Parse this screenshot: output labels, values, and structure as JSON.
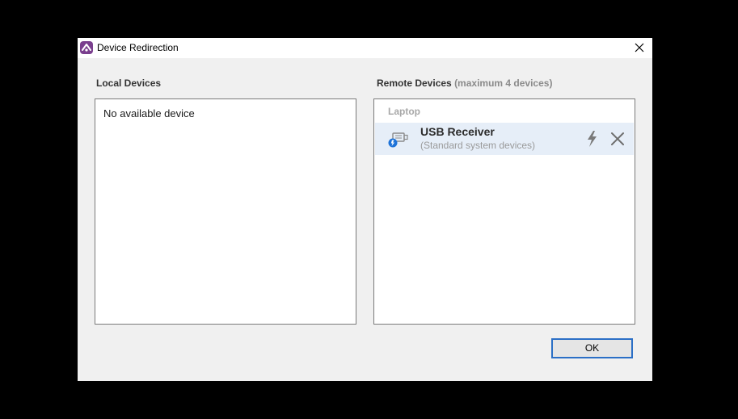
{
  "window": {
    "title": "Device Redirection",
    "app_icon": "anydesk-style-app-icon",
    "close_icon": "close-icon"
  },
  "local": {
    "label": "Local Devices",
    "empty_text": "No available device"
  },
  "remote": {
    "label": "Remote Devices",
    "label_sub": "(maximum 4 devices)",
    "group": "Laptop",
    "devices": [
      {
        "name": "USB Receiver",
        "description": "(Standard system devices)",
        "icon": "usb-device-icon",
        "connect_icon": "lightning-bolt-icon",
        "remove_icon": "close-icon"
      }
    ]
  },
  "footer": {
    "ok_label": "OK"
  },
  "colors": {
    "accent": "#2b6fc6",
    "app_icon": "#7a3f8e",
    "selected_row": "#e6eef8"
  }
}
